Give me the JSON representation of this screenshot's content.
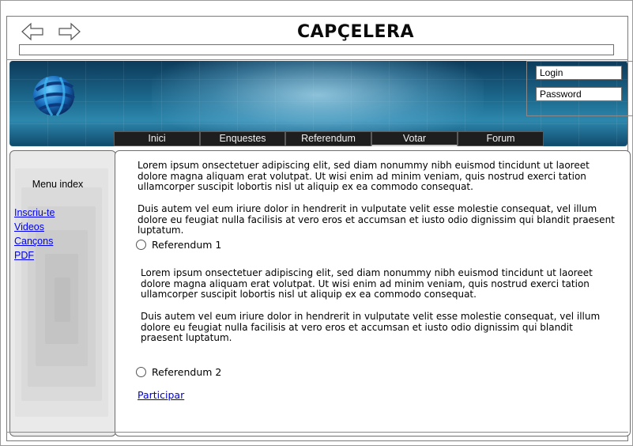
{
  "browser": {
    "back_icon": "back-arrow-icon",
    "forward_icon": "forward-arrow-icon",
    "address_value": ""
  },
  "header": {
    "title": "CAPÇELERA",
    "logo_icon": "globe-logo-icon"
  },
  "login": {
    "username_placeholder": "Login",
    "password_placeholder": "Password"
  },
  "nav": {
    "tabs": [
      {
        "label": "Inici"
      },
      {
        "label": "Enquestes"
      },
      {
        "label": "Referendum"
      },
      {
        "label": "Votar",
        "active": true
      },
      {
        "label": "Forum"
      }
    ]
  },
  "sidebar": {
    "title": "Menu index",
    "links": [
      {
        "label": "Inscriu-te"
      },
      {
        "label": "Videos"
      },
      {
        "label": "Cançons"
      },
      {
        "label": "PDF"
      }
    ]
  },
  "main": {
    "intro_paragraphs": [
      "Lorem ipsum onsectetuer adipiscing elit, sed diam nonummy nibh euismod tincidunt ut laoreet dolore magna aliquam erat volutpat. Ut wisi enim ad minim veniam, quis nostrud exerci tation ullamcorper suscipit lobortis nisl ut aliquip ex ea commodo consequat.",
      "Duis autem vel eum iriure dolor in hendrerit in vulputate velit esse molestie consequat, vel illum dolore eu feugiat nulla facilisis at vero eros et accumsan et iusto odio dignissim qui blandit praesent luptatum."
    ],
    "option1_label": "Referendum 1",
    "option1_paragraphs": [
      "Lorem ipsum onsectetuer adipiscing elit, sed diam nonummy nibh euismod tincidunt ut laoreet dolore magna aliquam erat volutpat. Ut wisi enim ad minim veniam, quis nostrud exerci tation ullamcorper suscipit lobortis nisl ut aliquip ex ea commodo consequat.",
      "Duis autem vel eum iriure dolor in hendrerit in vulputate velit esse molestie consequat, vel illum dolore eu feugiat nulla facilisis at vero eros et accumsan et iusto odio dignissim qui blandit praesent luptatum."
    ],
    "option2_label": "Referendum 2",
    "participate_label": "Participar"
  },
  "colors": {
    "banner_dark": "#0d3a5a",
    "banner_light": "#2d87ad",
    "tab_background": "#1e1e1e",
    "link": "#0000ee"
  }
}
